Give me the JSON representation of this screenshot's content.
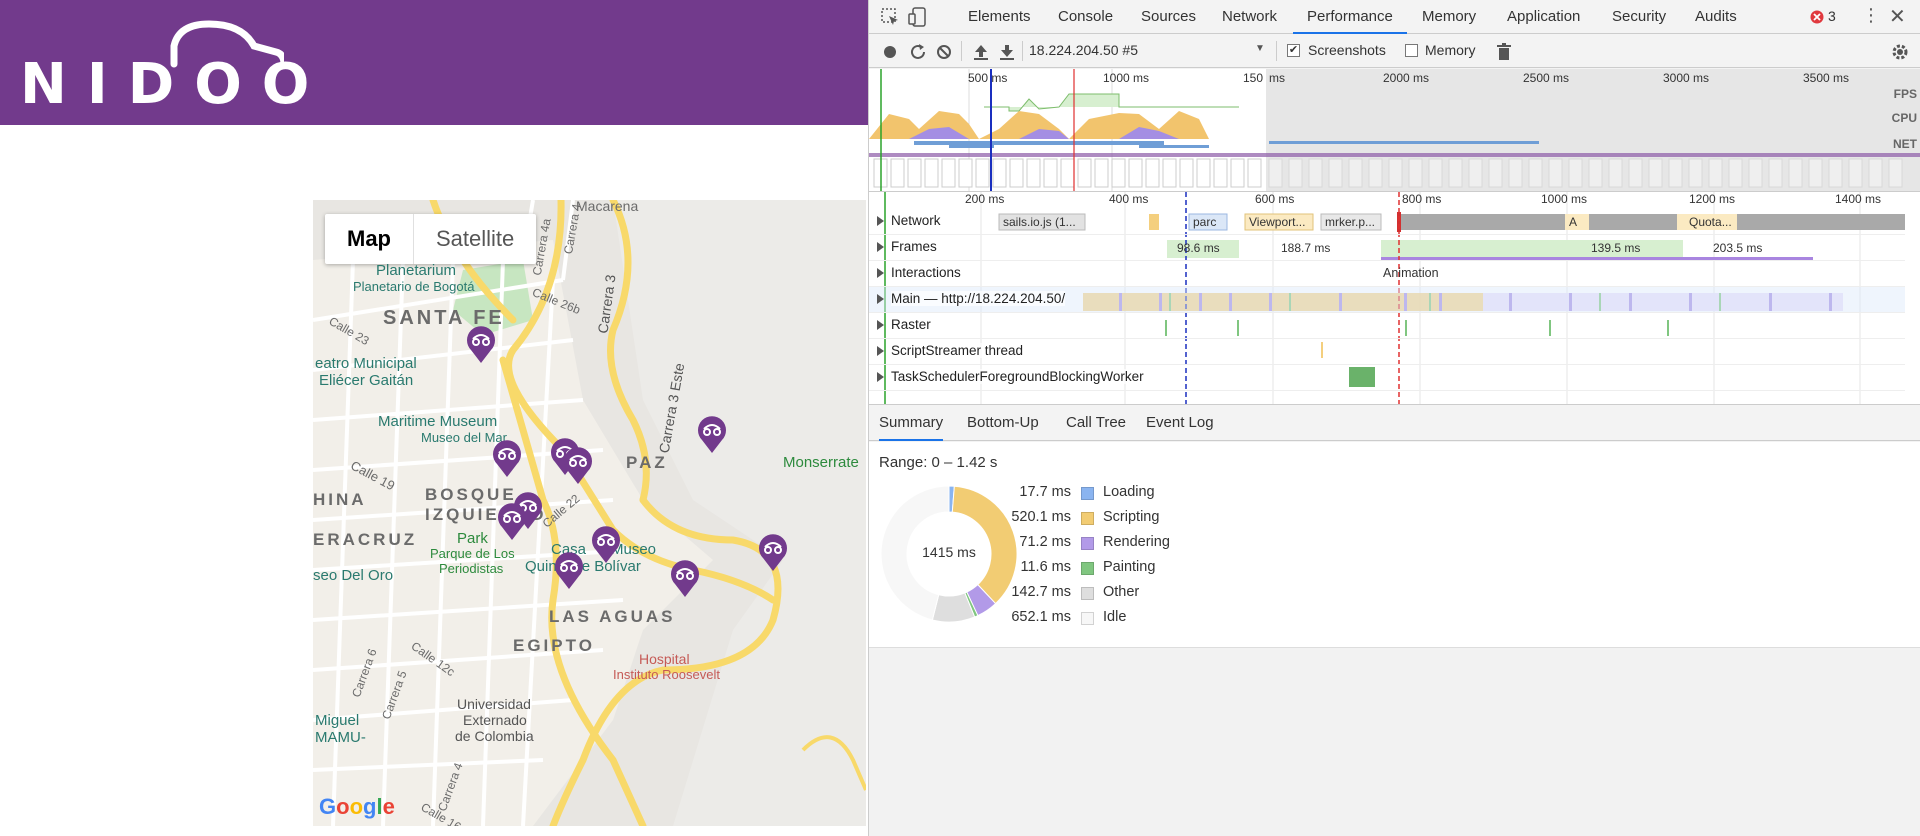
{
  "site": {
    "brand_name": "NIDOO",
    "colors": {
      "brand": "#723a8c"
    }
  },
  "map": {
    "tabs": [
      {
        "label": "Map",
        "active": true
      },
      {
        "label": "Satellite",
        "active": false
      }
    ],
    "labels": {
      "macarena": "Macarena",
      "planetarium": "Planetarium",
      "planetario": "Planetario de Bogotá",
      "santa_fe": "SANTA FE",
      "teatro1": "eatro Municipal",
      "teatro2": "Eliécer Gaitán",
      "maritime1": "Maritime Museum",
      "maritime2": "Museo del Mar",
      "la_paz": "PAZ",
      "monserrate": "Monserrate",
      "bosque1": "BOSQUE",
      "bosque2": "IZQUIERDO",
      "hina": "HINA",
      "eracruz": "ERACRUZ",
      "park1": "Park",
      "park2": "Parque de Los",
      "park3": "Periodistas",
      "casa1": "Casa",
      "casa2": "Museo",
      "casa3": "Quinta de Bolívar",
      "museo_oro": "seo Del Oro",
      "las_aguas": "LAS AGUAS",
      "egipto": "EGIPTO",
      "hospital1": "Hospital",
      "hospital2": "Instituto Roosevelt",
      "univ1": "Universidad",
      "univ2": "Externado",
      "univ3": "de Colombia",
      "miguel1": "Miguel",
      "miguel2": "MAMU-",
      "carrera3": "Carrera 3",
      "carrera3este": "Carrera 3 Este",
      "carrera4": "Carrera 4",
      "carrera4a": "Carrera 4a",
      "calle26b": "Calle 26b",
      "calle23": "Calle 23",
      "calle19": "Calle 19",
      "calle22": "Calle 22",
      "carrera6": "Carrera 6",
      "carrera5": "Carrera 5",
      "calle12c": "Calle 12c",
      "carrera4b": "Carrera 4",
      "calle16": "Calle 16"
    },
    "google_logo": "Google"
  },
  "devtools": {
    "main_tabs": [
      {
        "label": "Elements",
        "active": false
      },
      {
        "label": "Console",
        "active": false
      },
      {
        "label": "Sources",
        "active": false
      },
      {
        "label": "Network",
        "active": false
      },
      {
        "label": "Performance",
        "active": true
      },
      {
        "label": "Memory",
        "active": false
      },
      {
        "label": "Application",
        "active": false
      },
      {
        "label": "Security",
        "active": false
      },
      {
        "label": "Audits",
        "active": false
      }
    ],
    "error_count": "3",
    "toolbar": {
      "profile_select": "18.224.204.50 #5",
      "screenshots_label": "Screenshots",
      "screenshots_checked": true,
      "memory_label": "Memory",
      "memory_checked": false
    },
    "overview": {
      "ruler": [
        "500 ms",
        "1000 ms",
        "150",
        "ms",
        "2000 ms",
        "2500 ms",
        "3000 ms",
        "3500 ms"
      ],
      "lane_labels": [
        "FPS",
        "CPU",
        "NET"
      ]
    },
    "timeline_ruler": [
      "200 ms",
      "400 ms",
      "600 ms",
      "800 ms",
      "1000 ms",
      "1200 ms",
      "1400 ms"
    ],
    "tracks": [
      {
        "name": "Network"
      },
      {
        "name": "Frames"
      },
      {
        "name": "Interactions"
      },
      {
        "name": "Main — http://18.224.204.50/"
      },
      {
        "name": "Raster"
      },
      {
        "name": "ScriptStreamer thread"
      },
      {
        "name": "TaskSchedulerForegroundBlockingWorker"
      }
    ],
    "network_items": [
      "sails.io.js (1...",
      "parc",
      "Viewport...",
      "m",
      "rker.p...",
      "A",
      "Quota..."
    ],
    "frame_times": [
      "98.6 ms",
      "188.7 ms",
      "139.5 ms",
      "203.5 ms"
    ],
    "interaction_label": "Animation",
    "summary_tabs": [
      {
        "label": "Summary",
        "active": true
      },
      {
        "label": "Bottom-Up",
        "active": false
      },
      {
        "label": "Call Tree",
        "active": false
      },
      {
        "label": "Event Log",
        "active": false
      }
    ],
    "summary": {
      "range": "Range: 0 – 1.42 s",
      "total": "1415 ms",
      "categories": [
        {
          "ms": "17.7 ms",
          "name": "Loading",
          "value": 17.7,
          "color": "#8ab4f0"
        },
        {
          "ms": "520.1 ms",
          "name": "Scripting",
          "value": 520.1,
          "color": "#f2cc73"
        },
        {
          "ms": "71.2 ms",
          "name": "Rendering",
          "value": 71.2,
          "color": "#b29ae8"
        },
        {
          "ms": "11.6 ms",
          "name": "Painting",
          "value": 11.6,
          "color": "#80c680"
        },
        {
          "ms": "142.7 ms",
          "name": "Other",
          "value": 142.7,
          "color": "#dedede"
        },
        {
          "ms": "652.1 ms",
          "name": "Idle",
          "value": 652.1,
          "color": "#f7f7f7"
        }
      ]
    }
  }
}
